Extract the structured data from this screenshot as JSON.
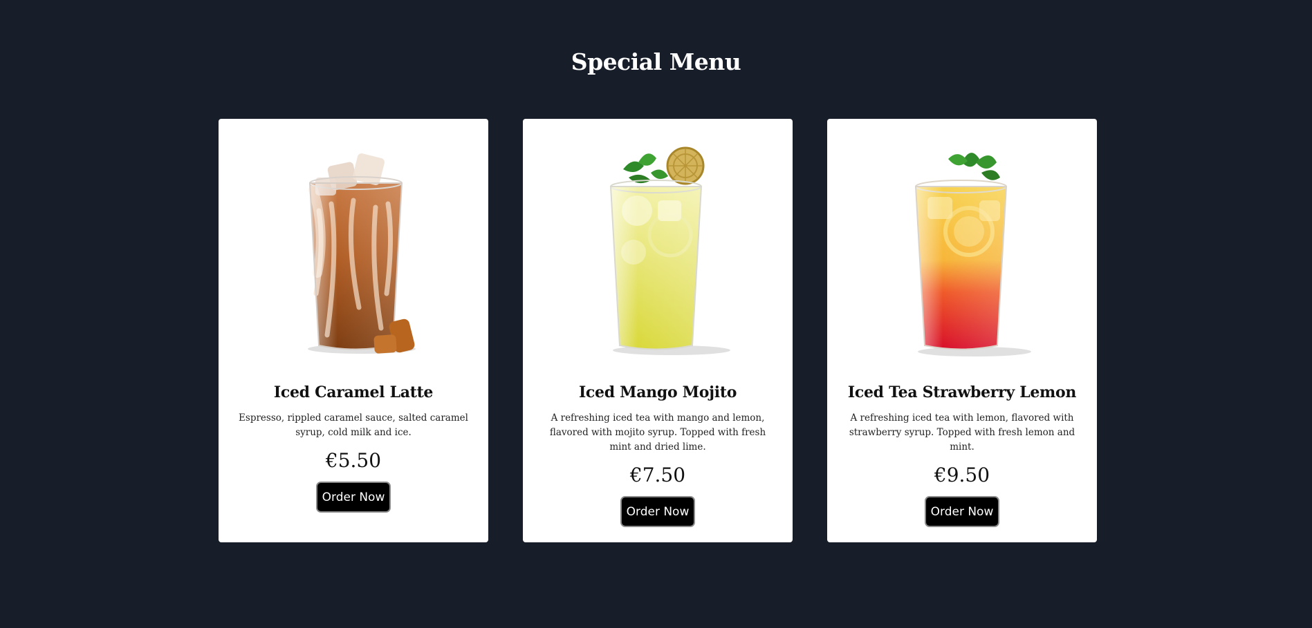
{
  "page": {
    "title": "Special Menu"
  },
  "colors": {
    "background": "#171d29",
    "card": "#ffffff",
    "button": "#000000",
    "button_text": "#ffffff"
  },
  "menu": {
    "items": [
      {
        "name": "Iced Caramel Latte",
        "description": "Espresso, rippled caramel sauce, salted caramel syrup, cold milk and ice.",
        "price": "€5.50",
        "button_label": "Order Now",
        "image": "iced-caramel-latte-image"
      },
      {
        "name": "Iced Mango Mojito",
        "description": "A refreshing iced tea with mango and lemon, flavored with mojito syrup. Topped with fresh mint and dried lime.",
        "price": "€7.50",
        "button_label": "Order Now",
        "image": "iced-mango-mojito-image"
      },
      {
        "name": "Iced Tea Strawberry Lemon",
        "description": "A refreshing iced tea with lemon, flavored with strawberry syrup. Topped with fresh lemon and mint.",
        "price": "€9.50",
        "button_label": "Order Now",
        "image": "iced-tea-strawberry-lemon-image"
      }
    ]
  }
}
